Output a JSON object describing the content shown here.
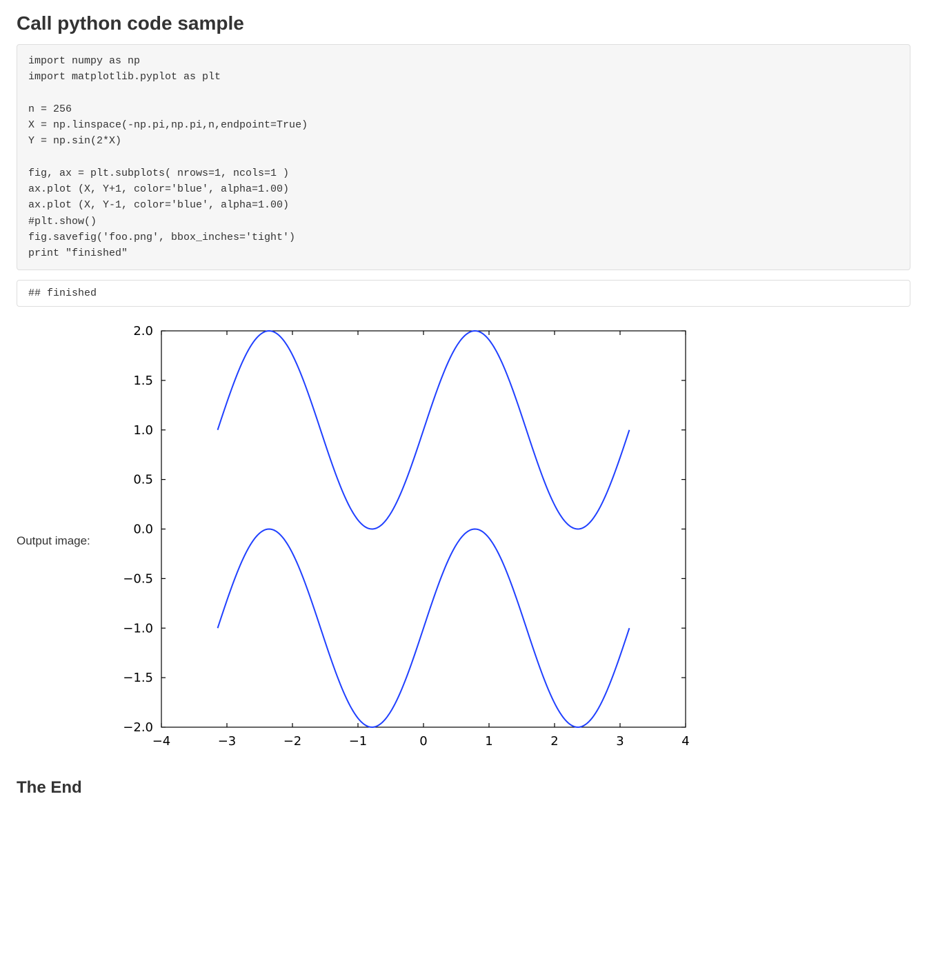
{
  "heading": "Call python code sample",
  "code": "import numpy as np\nimport matplotlib.pyplot as plt\n\nn = 256\nX = np.linspace(-np.pi,np.pi,n,endpoint=True)\nY = np.sin(2*X)\n\nfig, ax = plt.subplots( nrows=1, ncols=1 )\nax.plot (X, Y+1, color='blue', alpha=1.00)\nax.plot (X, Y-1, color='blue', alpha=1.00)\n#plt.show()\nfig.savefig('foo.png', bbox_inches='tight')\nprint \"finished\"",
  "output_text": "## finished",
  "output_image_label": "Output image:",
  "footer": "The End",
  "chart_data": {
    "type": "line",
    "title": "",
    "xlabel": "",
    "ylabel": "",
    "xlim": [
      -4,
      4
    ],
    "ylim": [
      -2.0,
      2.0
    ],
    "xticks": [
      -4,
      -3,
      -2,
      -1,
      0,
      1,
      2,
      3,
      4
    ],
    "yticks": [
      -2.0,
      -1.5,
      -1.0,
      -0.5,
      0.0,
      0.5,
      1.0,
      1.5,
      2.0
    ],
    "x_range": [
      -3.14159,
      3.14159
    ],
    "n_points": 256,
    "series": [
      {
        "name": "sin(2X)+1",
        "formula": "sin(2x)+1",
        "color": "#2040ff"
      },
      {
        "name": "sin(2X)-1",
        "formula": "sin(2x)-1",
        "color": "#2040ff"
      }
    ],
    "grid": false,
    "legend": false
  }
}
